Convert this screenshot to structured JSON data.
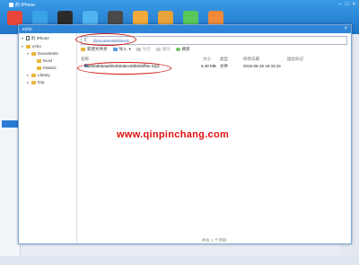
{
  "app": {
    "title": "的 iPhone"
  },
  "toolbar": {
    "icons": [
      {
        "name": "store-icon",
        "color": "#e8463b"
      },
      {
        "name": "photos-icon",
        "color": "#3aa3e8"
      },
      {
        "name": "music-icon",
        "color": "#2b2b2b"
      },
      {
        "name": "wallpaper-icon",
        "color": "#4fb4f0"
      },
      {
        "name": "video-icon",
        "color": "#4a4a4a"
      },
      {
        "name": "apps-icon",
        "color": "#f2a83a"
      },
      {
        "name": "books-icon",
        "color": "#e8a23a"
      },
      {
        "name": "games-icon",
        "color": "#58c85a"
      },
      {
        "name": "more-icon",
        "color": "#f08a3a"
      }
    ]
  },
  "dialog": {
    "title": "echo",
    "close": "×",
    "tree": {
      "device": "的 iPhone",
      "items": [
        {
          "label": "echo",
          "level": 0
        },
        {
          "label": "Documents",
          "level": 1
        },
        {
          "label": "KList",
          "level": 2
        },
        {
          "label": "KMusic",
          "level": 2
        },
        {
          "label": "Library",
          "level": 1
        },
        {
          "label": "tmp",
          "level": 1
        }
      ]
    },
    "path": "/Documents/KMusic",
    "actions": [
      {
        "label": "新建文件夹",
        "disabled": false
      },
      {
        "label": "导入",
        "disabled": false
      },
      {
        "label": "导出",
        "disabled": true
      },
      {
        "label": "删除",
        "disabled": true
      },
      {
        "label": "刷新",
        "disabled": false
      }
    ],
    "columns": [
      "名称",
      "大小",
      "类型",
      "修改日期",
      "固化标记"
    ],
    "files": [
      {
        "name": "f0d90a855aa805450a6ec89b05bff5e.mp3",
        "size": "6.48 MB",
        "type": "文件",
        "date": "2015-06-15 15:43:16",
        "flag": ""
      }
    ],
    "status": "共有 1 个项目"
  },
  "watermark": "www.qinpinchang.com",
  "colors": {
    "accent": "#2f86d9",
    "annotation": "#d01818"
  }
}
